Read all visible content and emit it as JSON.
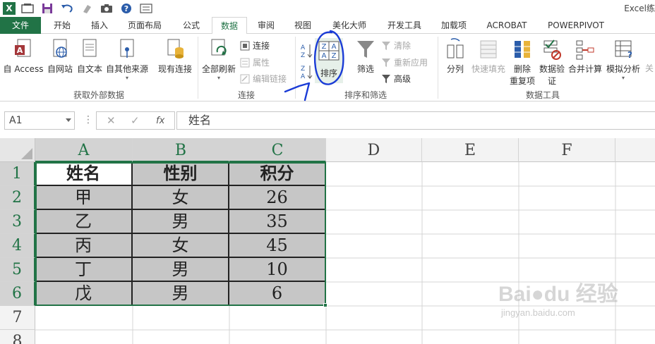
{
  "title": "Excel练",
  "tabs": [
    {
      "label": "文件"
    },
    {
      "label": "开始"
    },
    {
      "label": "插入"
    },
    {
      "label": "页面布局"
    },
    {
      "label": "公式"
    },
    {
      "label": "数据"
    },
    {
      "label": "审阅"
    },
    {
      "label": "视图"
    },
    {
      "label": "美化大师"
    },
    {
      "label": "开发工具"
    },
    {
      "label": "加载项"
    },
    {
      "label": "ACROBAT"
    },
    {
      "label": "POWERPIVOT"
    }
  ],
  "ribbon": {
    "external": {
      "access": "自 Access",
      "web": "自网站",
      "text": "自文本",
      "other": "自其他来源",
      "existing": "现有连接",
      "group_label": "获取外部数据"
    },
    "connections": {
      "refresh_all": "全部刷新",
      "connections": "连接",
      "properties": "属性",
      "edit_links": "编辑链接",
      "group_label": "连接"
    },
    "sort_filter": {
      "sort": "排序",
      "filter": "筛选",
      "clear": "清除",
      "reapply": "重新应用",
      "advanced": "高级",
      "group_label": "排序和筛选"
    },
    "tools": {
      "text_to_columns": "分列",
      "flash_fill": "快速填充",
      "remove_dup_1": "删除",
      "remove_dup_2": "重复项",
      "validation_1": "数据验",
      "validation_2": "证",
      "consolidate": "合并计算",
      "whatif": "模拟分析",
      "more": "关",
      "group_label": "数据工具"
    }
  },
  "formula_bar": {
    "name_box": "A1",
    "fx": "fx",
    "content": "姓名"
  },
  "columns": [
    "A",
    "B",
    "C",
    "D",
    "E",
    "F"
  ],
  "rows": [
    "1",
    "2",
    "3",
    "4",
    "5",
    "6",
    "7",
    "8"
  ],
  "table": {
    "header": [
      "姓名",
      "性别",
      "积分"
    ],
    "rows": [
      [
        "甲",
        "女",
        "26"
      ],
      [
        "乙",
        "男",
        "35"
      ],
      [
        "丙",
        "女",
        "45"
      ],
      [
        "丁",
        "男",
        "10"
      ],
      [
        "戊",
        "男",
        "6"
      ]
    ]
  },
  "watermark": {
    "brand": "Bai●du 经验",
    "url": "jingyan.baidu.com"
  },
  "colors": {
    "excel_green": "#217346",
    "annotation_blue": "#1a3bd6"
  }
}
